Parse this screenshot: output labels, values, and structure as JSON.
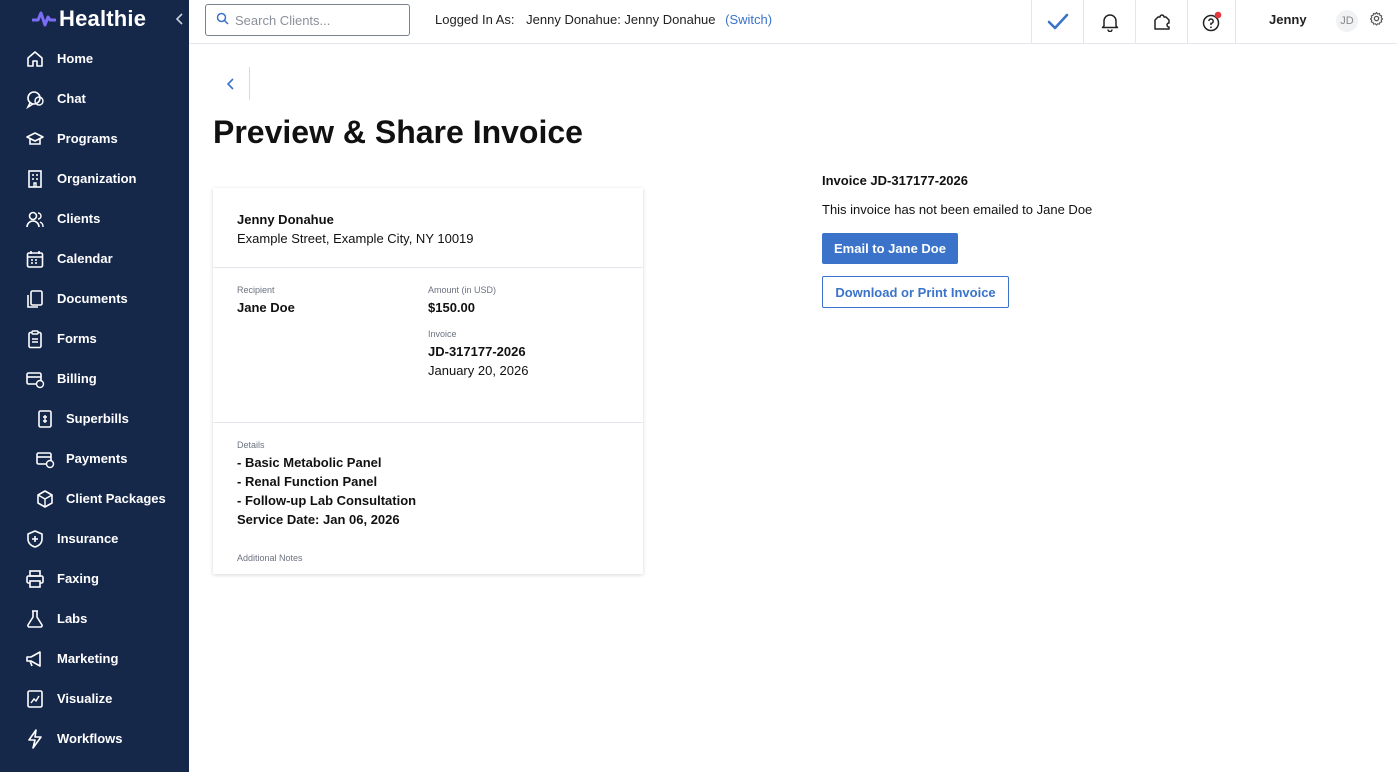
{
  "app": {
    "logo_text": "Healthie",
    "brand_color": "#16284a",
    "accent_color": "#3a73c9"
  },
  "sidebar": {
    "items": [
      {
        "label": "Home",
        "icon": "home-icon"
      },
      {
        "label": "Chat",
        "icon": "chat-icon"
      },
      {
        "label": "Programs",
        "icon": "graduation-cap-icon"
      },
      {
        "label": "Organization",
        "icon": "building-icon"
      },
      {
        "label": "Clients",
        "icon": "users-icon"
      },
      {
        "label": "Calendar",
        "icon": "calendar-icon"
      },
      {
        "label": "Documents",
        "icon": "documents-icon"
      },
      {
        "label": "Forms",
        "icon": "clipboard-icon"
      },
      {
        "label": "Billing",
        "icon": "billing-icon"
      },
      {
        "label": "Superbills",
        "icon": "superbill-icon"
      },
      {
        "label": "Payments",
        "icon": "payments-icon"
      },
      {
        "label": "Client Packages",
        "icon": "package-icon"
      },
      {
        "label": "Insurance",
        "icon": "shield-icon"
      },
      {
        "label": "Faxing",
        "icon": "printer-icon"
      },
      {
        "label": "Labs",
        "icon": "flask-icon"
      },
      {
        "label": "Marketing",
        "icon": "megaphone-icon"
      },
      {
        "label": "Visualize",
        "icon": "chart-icon"
      },
      {
        "label": "Workflows",
        "icon": "bolt-icon"
      }
    ]
  },
  "topbar": {
    "search_placeholder": "Search Clients...",
    "logged_in_label": "Logged In As:",
    "logged_in_user": "Jenny Donahue: Jenny Donahue",
    "switch_label": "(Switch)",
    "user_first_name": "Jenny",
    "avatar_initials": "JD",
    "notification_dot_color": "#e5383b"
  },
  "main": {
    "title": "Preview & Share Invoice"
  },
  "invoice_card": {
    "provider_name": "Jenny Donahue",
    "provider_address": "Example Street, Example City, NY 10019",
    "recipient_label": "Recipient",
    "recipient_name": "Jane Doe",
    "amount_label": "Amount (in USD)",
    "amount": "$150.00",
    "invoice_label": "Invoice",
    "invoice_number": "JD-317177-2026",
    "invoice_date": "January 20, 2026",
    "details_label": "Details",
    "details_lines": [
      "- Basic Metabolic Panel",
      "- Renal Function Panel",
      "- Follow-up Lab Consultation",
      "Service Date: Jan 06, 2026"
    ],
    "additional_notes_label": "Additional Notes"
  },
  "share_panel": {
    "heading": "Invoice JD-317177-2026",
    "status": "This invoice has not been emailed to Jane Doe",
    "email_button": "Email to Jane Doe",
    "download_button": "Download or Print Invoice"
  }
}
